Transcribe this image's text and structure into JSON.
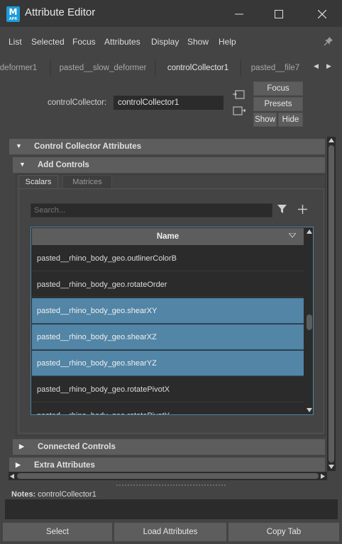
{
  "window": {
    "app_icon_letter": "M",
    "app_icon_sub": "APR",
    "title": "Attribute Editor",
    "minimize_glyph": "—",
    "maximize_glyph": "☐",
    "close_glyph": "✕"
  },
  "menu": [
    "List",
    "Selected",
    "Focus",
    "Attributes",
    "Display",
    "Show",
    "Help"
  ],
  "tabs": [
    {
      "label": "deformer1"
    },
    {
      "label": "pasted__slow_deformer"
    },
    {
      "label": "controlCollector1"
    },
    {
      "label": "pasted__file7"
    }
  ],
  "tab_nav": {
    "prev": "◀",
    "next": "▶"
  },
  "node": {
    "label": "controlCollector:",
    "value": "controlCollector1"
  },
  "buttons": {
    "focus": "Focus",
    "presets": "Presets",
    "show": "Show",
    "hide": "Hide"
  },
  "sections": {
    "main": "Control Collector Attributes",
    "add_controls": "Add Controls",
    "connected_controls": "Connected Controls",
    "extra_attributes": "Extra Attributes",
    "expanded_arrow": "▼",
    "collapsed_arrow": "▶"
  },
  "subtabs": [
    "Scalars",
    "Matrices"
  ],
  "search": {
    "placeholder": "Search..."
  },
  "table": {
    "column": "Name",
    "rows": [
      {
        "name": "pasted__rhino_body_geo.outlinerColorB",
        "selected": false
      },
      {
        "name": "pasted__rhino_body_geo.rotateOrder",
        "selected": false
      },
      {
        "name": "pasted__rhino_body_geo.shearXY",
        "selected": true
      },
      {
        "name": "pasted__rhino_body_geo.shearXZ",
        "selected": true
      },
      {
        "name": "pasted__rhino_body_geo.shearYZ",
        "selected": true
      },
      {
        "name": "pasted__rhino_body_geo.rotatePivotX",
        "selected": false
      },
      {
        "name": "pasted__rhino_body_geo.rotatePivotY",
        "selected": false
      }
    ]
  },
  "notes": {
    "label": "Notes:",
    "value": "controlCollector1"
  },
  "bottom": {
    "select": "Select",
    "load": "Load Attributes",
    "copy": "Copy Tab"
  },
  "colors": {
    "selection": "#5285a6",
    "background": "#444444",
    "field": "#2b2b2b",
    "header": "#5d5d5d"
  }
}
